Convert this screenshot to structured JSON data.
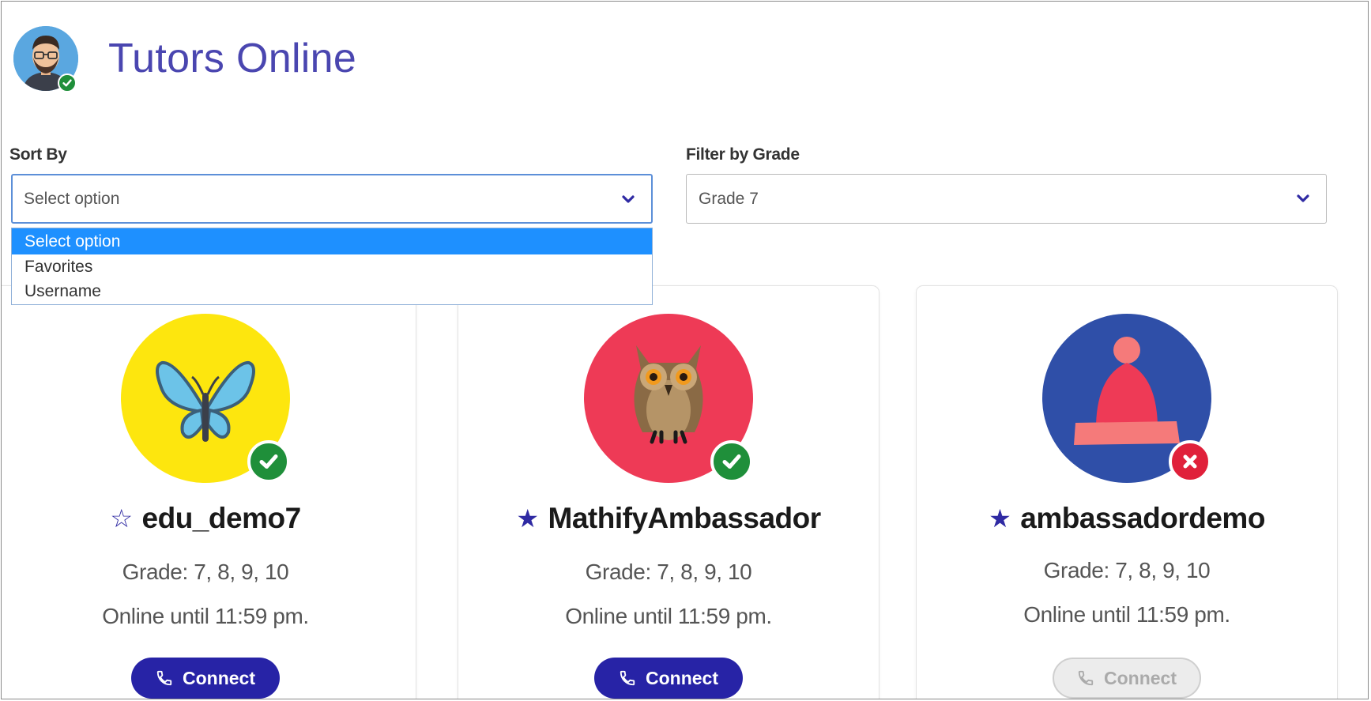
{
  "header": {
    "title": "Tutors Online",
    "avatar_icon": "user-avatar-icon",
    "status": "online"
  },
  "sort": {
    "label": "Sort By",
    "value": "Select option",
    "options": [
      "Select option",
      "Favorites",
      "Username"
    ],
    "open": true
  },
  "filter": {
    "label": "Filter by Grade",
    "value": "Grade 7"
  },
  "tutors": [
    {
      "name": "edu_demo7",
      "favorite": false,
      "avatar": "butterfly-icon",
      "avatar_color": "#fde60e",
      "status": "online",
      "grade": "Grade: 7, 8, 9, 10",
      "online_until": "Online until 11:59 pm.",
      "connect": "Connect",
      "connect_enabled": true
    },
    {
      "name": "MathifyAmbassador",
      "favorite": true,
      "avatar": "owl-icon",
      "avatar_color": "#ee3a56",
      "status": "online",
      "grade": "Grade: 7, 8, 9, 10",
      "online_until": "Online until 11:59 pm.",
      "connect": "Connect",
      "connect_enabled": true
    },
    {
      "name": "ambassadordemo",
      "favorite": true,
      "avatar": "beanie-hat-icon",
      "avatar_color": "#2f4fa8",
      "status": "offline",
      "grade": "Grade: 7, 8, 9, 10",
      "online_until": "Online until 11:59 pm.",
      "connect": "Connect",
      "connect_enabled": false
    }
  ],
  "colors": {
    "brand": "#4a46b0",
    "button": "#2723a6",
    "online": "#1f8f3a",
    "offline": "#e0203a",
    "selected_option": "#1e90ff"
  }
}
